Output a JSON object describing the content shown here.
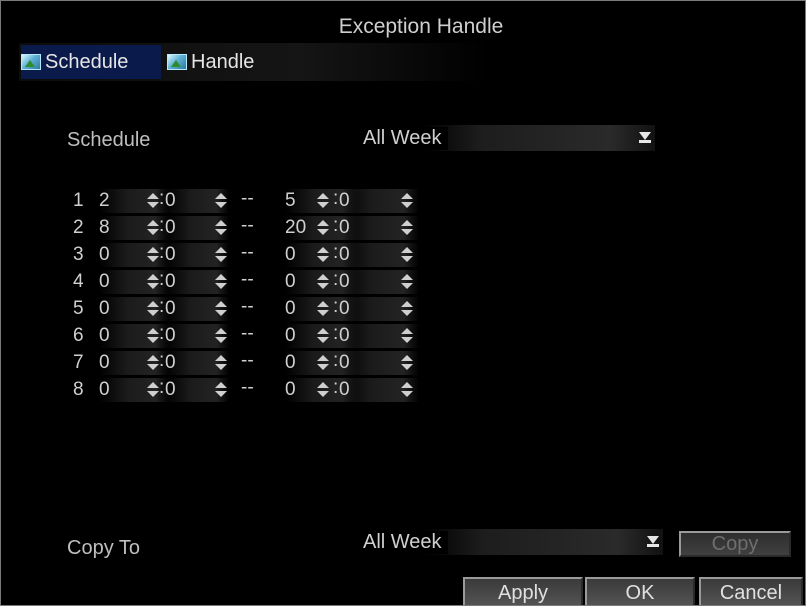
{
  "window": {
    "title": "Exception Handle"
  },
  "tabs": [
    {
      "label": "Schedule",
      "icon": "picture-icon",
      "active": true
    },
    {
      "label": "Handle",
      "icon": "picture-icon",
      "active": false
    }
  ],
  "schedule": {
    "label": "Schedule",
    "value": "All Week"
  },
  "time_rows": [
    {
      "num": "1",
      "start_hour": "2",
      "start_min": "0",
      "end_hour": "5",
      "end_min": "0"
    },
    {
      "num": "2",
      "start_hour": "8",
      "start_min": "0",
      "end_hour": "20",
      "end_min": "0"
    },
    {
      "num": "3",
      "start_hour": "0",
      "start_min": "0",
      "end_hour": "0",
      "end_min": "0"
    },
    {
      "num": "4",
      "start_hour": "0",
      "start_min": "0",
      "end_hour": "0",
      "end_min": "0"
    },
    {
      "num": "5",
      "start_hour": "0",
      "start_min": "0",
      "end_hour": "0",
      "end_min": "0"
    },
    {
      "num": "6",
      "start_hour": "0",
      "start_min": "0",
      "end_hour": "0",
      "end_min": "0"
    },
    {
      "num": "7",
      "start_hour": "0",
      "start_min": "0",
      "end_hour": "0",
      "end_min": "0"
    },
    {
      "num": "8",
      "start_hour": "0",
      "start_min": "0",
      "end_hour": "0",
      "end_min": "0"
    }
  ],
  "separators": {
    "colon": ":",
    "dash": "--"
  },
  "copy_to": {
    "label": "Copy To",
    "value": "All Week",
    "button": "Copy"
  },
  "buttons": {
    "apply": "Apply",
    "ok": "OK",
    "cancel": "Cancel"
  },
  "colors": {
    "background": "#000000",
    "text": "#d0d0d0",
    "active_tab": "#0a1a4a"
  }
}
